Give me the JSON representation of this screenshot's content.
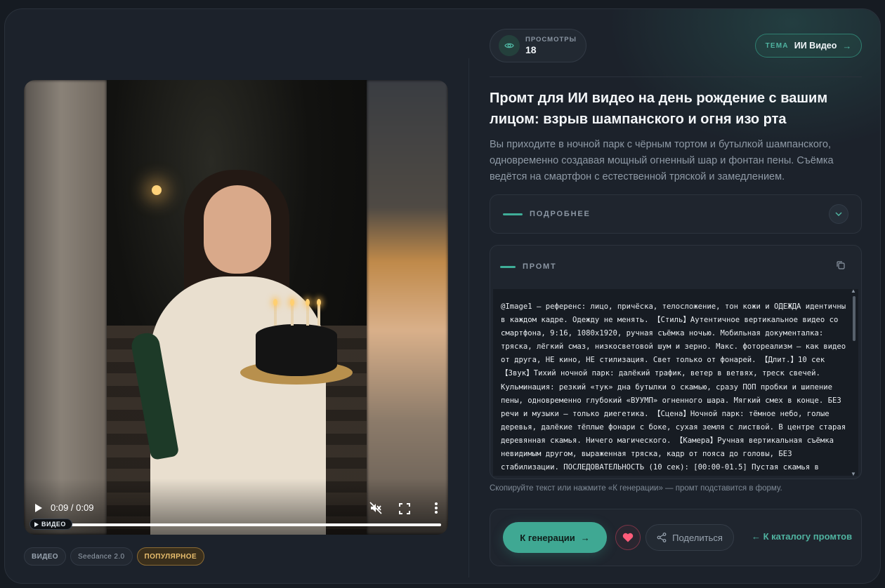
{
  "views": {
    "label": "ПРОСМОТРЫ",
    "count": "18"
  },
  "theme": {
    "label": "ТЕМА",
    "value": "ИИ Видео",
    "arrow": "→"
  },
  "title": "Промт для ИИ видео на день рождение с вашим лицом: взрыв шампанского и огня изо рта",
  "subtitle": "Вы приходите в ночной парк с чёрным тортом и бутылкой шампанского, одновременно создавая мощный огненный шар и фонтан пены. Съёмка ведётся на смартфон с естественной тряской и замедлением.",
  "details": {
    "label": "ПОДРОБНЕЕ"
  },
  "prompt": {
    "label": "ПРОМТ",
    "text": "@Image1 — референс: лицо, причёска, телосложение, тон кожи и ОДЕЖДА идентичны в каждом кадре. Одежду не менять. 【Стиль】Аутентичное вертикальное видео со смартфона, 9:16, 1080x1920, ручная съёмка ночью. Мобильная документалка: тряска, лёгкий смаз, низкосветовой шум и зерно. Макс. фотореализм — как видео от друга, НЕ кино, НЕ стилизация. Свет только от фонарей. 【Длит.】10 сек 【Звук】Тихий ночной парк: далёкий трафик, ветер в ветвях, треск свечей. Кульминация: резкий «тук» дна бутылки о скамью, сразу ПОП пробки и шипение пены, одновременно глубокий «ВУУМП» огненного шара. Мягкий смех в конце. БЕЗ речи и музыки — только диегетика. 【Сцена】Ночной парк: тёмное небо, голые деревья, далёкие тёплые фонари с боке, сухая земля с листвой. В центре старая деревянная скамья. Ничего магического. 【Камера】Ручная вертикальная съёмка невидимым другом, выраженная тряска, кадр от пояса до головы, БЕЗ стабилизации. ПОСЛЕДОВАТЕЛЬНОСТЬ (10 сек): [00:00-01.5] Пустая скамья в центре. Персонаж входит справа, бодро идёт"
  },
  "hint": "Скопируйте текст или нажмите «К генерации» — промт подставится в форму.",
  "actions": {
    "generate": "К генерации",
    "generate_arrow": "→",
    "share": "Поделиться",
    "catalog": "← К каталогу промтов"
  },
  "video": {
    "time": "0:09 / 0:09",
    "badge": "ВИДЕО",
    "progress": 1.0
  },
  "chips": [
    "ВИДЕО",
    "Seedance 2.0",
    "ПОПУЛЯРНОЕ"
  ],
  "colors": {
    "accent": "#3fa893",
    "gold": "#e9be6d",
    "background": "#1c222b"
  }
}
